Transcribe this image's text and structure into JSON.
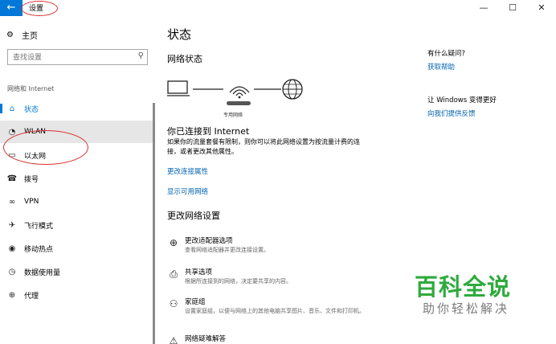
{
  "window": {
    "title": "设置",
    "back_icon": "←",
    "min_icon": "—",
    "max_icon": "☐",
    "close_icon": "✕"
  },
  "nav": {
    "home_label": "主页",
    "search_placeholder": "查找设置",
    "section_title": "网络和 Internet",
    "items": [
      {
        "label": "状态",
        "icon": "home-status-icon",
        "glyph": "⌂"
      },
      {
        "label": "WLAN",
        "icon": "wifi-icon",
        "glyph": "◔"
      },
      {
        "label": "以太网",
        "icon": "ethernet-icon",
        "glyph": "▭"
      },
      {
        "label": "拨号",
        "icon": "dialup-icon",
        "glyph": "☎"
      },
      {
        "label": "VPN",
        "icon": "vpn-icon",
        "glyph": "∞"
      },
      {
        "label": "飞行模式",
        "icon": "airplane-icon",
        "glyph": "✈"
      },
      {
        "label": "移动热点",
        "icon": "hotspot-icon",
        "glyph": "◉"
      },
      {
        "label": "数据使用量",
        "icon": "data-usage-icon",
        "glyph": "◷"
      },
      {
        "label": "代理",
        "icon": "proxy-icon",
        "glyph": "⊕"
      }
    ]
  },
  "main": {
    "page_title": "状态",
    "network_status_title": "网络状态",
    "network_name_caption": "专用网络",
    "connected_title": "你已连接到 Internet",
    "connected_desc": "如果你的流量套餐有限制，则你可以将此网络设置为按流量计费的连接，或者更改其他属性。",
    "link_change_props": "更改连接属性",
    "link_show_networks": "显示可用网络",
    "change_settings_title": "更改网络设置",
    "options": [
      {
        "title": "更改适配器选项",
        "desc": "查看网络适配器并更改连接设置。",
        "icon": "adapter-icon",
        "glyph": "⊕"
      },
      {
        "title": "共享选项",
        "desc": "根据所连接到的网络，决定要共享的内容。",
        "icon": "sharing-icon",
        "glyph": "⎙"
      },
      {
        "title": "家庭组",
        "desc": "设置家庭组，以便与网络上的其他电脑共享图片、音乐、文件和打印机。",
        "icon": "homegroup-icon",
        "glyph": "⚇"
      },
      {
        "title": "网络疑难解答",
        "desc": "",
        "icon": "troubleshoot-icon",
        "glyph": "⚠"
      }
    ]
  },
  "aside": {
    "question_title": "有什么疑问?",
    "question_link": "获取帮助",
    "improve_title": "让 Windows 变得更好",
    "improve_link": "向我们提供反馈"
  },
  "watermark": {
    "main": "百科全说",
    "sub": "助你轻松解决"
  }
}
